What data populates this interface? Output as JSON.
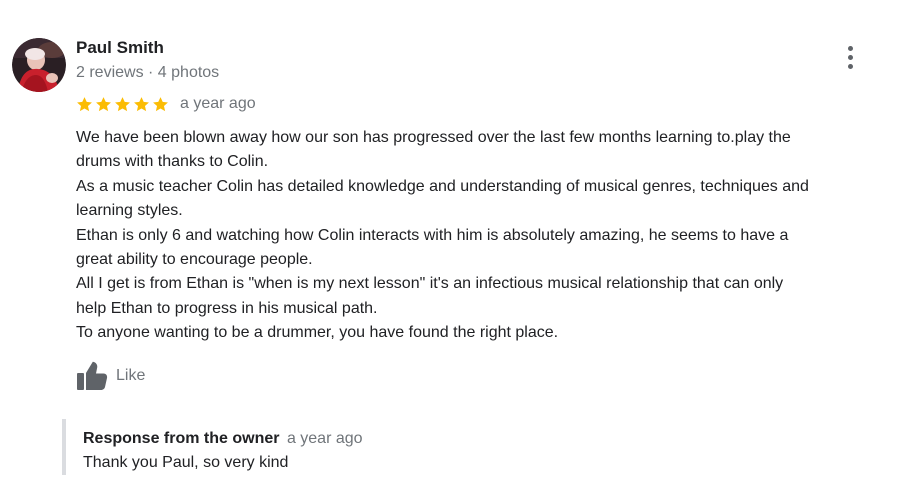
{
  "review": {
    "author": {
      "name": "Paul Smith",
      "meta": "2 reviews · 4 photos",
      "avatar_icon": "profile-photo-icon"
    },
    "rating": {
      "stars": 5,
      "max": 5,
      "star_color": "#fbbc04",
      "star_icon": "star-icon"
    },
    "date": "a year ago",
    "more_icon": "more-vert-icon",
    "text_lines": [
      "We have been blown away how our son has progressed over the last few months learning to.play the",
      "drums with thanks to Colin.",
      "As a music teacher Colin has detailed knowledge and understanding of musical genres, techniques and",
      "learning styles.",
      "Ethan is only 6 and watching how Colin interacts with him is absolutely amazing, he seems to have a",
      "great ability to encourage people.",
      "All I get is from Ethan is  \"when is my next lesson\" it's an infectious musical relationship that can only",
      "help Ethan to progress in his musical path.",
      "To anyone wanting to be a drummer, you have found the right place."
    ],
    "like": {
      "label": "Like",
      "icon": "thumbs-up-icon"
    },
    "owner_response": {
      "title": "Response from the owner",
      "date": "a year ago",
      "text": "Thank you Paul, so very kind"
    }
  },
  "colors": {
    "primary_text": "#202124",
    "secondary_text": "#70757a",
    "star": "#fbbc04",
    "icon": "#5f6368",
    "response_bar": "#dadce0"
  }
}
